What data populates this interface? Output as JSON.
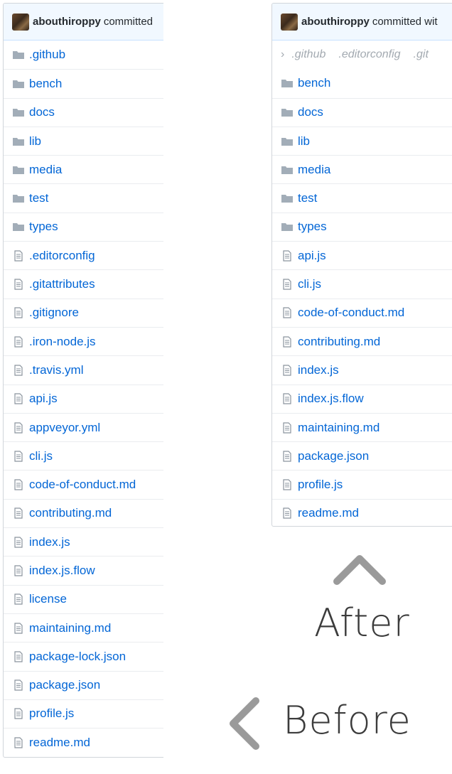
{
  "before": {
    "commit": {
      "author": "abouthiroppy",
      "text": "committed"
    },
    "items": [
      {
        "type": "folder",
        "name": ".github"
      },
      {
        "type": "folder",
        "name": "bench"
      },
      {
        "type": "folder",
        "name": "docs"
      },
      {
        "type": "folder",
        "name": "lib"
      },
      {
        "type": "folder",
        "name": "media"
      },
      {
        "type": "folder",
        "name": "test"
      },
      {
        "type": "folder",
        "name": "types"
      },
      {
        "type": "file",
        "name": ".editorconfig"
      },
      {
        "type": "file",
        "name": ".gitattributes"
      },
      {
        "type": "file",
        "name": ".gitignore"
      },
      {
        "type": "file",
        "name": ".iron-node.js"
      },
      {
        "type": "file",
        "name": ".travis.yml"
      },
      {
        "type": "file",
        "name": "api.js"
      },
      {
        "type": "file",
        "name": "appveyor.yml"
      },
      {
        "type": "file",
        "name": "cli.js"
      },
      {
        "type": "file",
        "name": "code-of-conduct.md"
      },
      {
        "type": "file",
        "name": "contributing.md"
      },
      {
        "type": "file",
        "name": "index.js"
      },
      {
        "type": "file",
        "name": "index.js.flow"
      },
      {
        "type": "file",
        "name": "license"
      },
      {
        "type": "file",
        "name": "maintaining.md"
      },
      {
        "type": "file",
        "name": "package-lock.json"
      },
      {
        "type": "file",
        "name": "package.json"
      },
      {
        "type": "file",
        "name": "profile.js"
      },
      {
        "type": "file",
        "name": "readme.md"
      }
    ]
  },
  "after": {
    "commit": {
      "author": "abouthiroppy",
      "text": "committed wit"
    },
    "dotfiles": [
      ".github",
      ".editorconfig",
      ".git"
    ],
    "items": [
      {
        "type": "folder",
        "name": "bench"
      },
      {
        "type": "folder",
        "name": "docs"
      },
      {
        "type": "folder",
        "name": "lib"
      },
      {
        "type": "folder",
        "name": "media"
      },
      {
        "type": "folder",
        "name": "test"
      },
      {
        "type": "folder",
        "name": "types"
      },
      {
        "type": "file",
        "name": "api.js"
      },
      {
        "type": "file",
        "name": "cli.js"
      },
      {
        "type": "file",
        "name": "code-of-conduct.md"
      },
      {
        "type": "file",
        "name": "contributing.md"
      },
      {
        "type": "file",
        "name": "index.js"
      },
      {
        "type": "file",
        "name": "index.js.flow"
      },
      {
        "type": "file",
        "name": "maintaining.md"
      },
      {
        "type": "file",
        "name": "package.json"
      },
      {
        "type": "file",
        "name": "profile.js"
      },
      {
        "type": "file",
        "name": "readme.md"
      }
    ]
  },
  "labels": {
    "after": "After",
    "before": "Before"
  },
  "icons": {
    "up": "chevron-up-icon",
    "left": "chevron-left-icon",
    "folder": "folder-icon",
    "file": "file-icon"
  },
  "colors": {
    "link": "#0366d6",
    "folder": "#79b8ff",
    "commit_bg": "#f1f8ff",
    "label": "#3c3c3c",
    "arrow": "#9a9a9a"
  }
}
